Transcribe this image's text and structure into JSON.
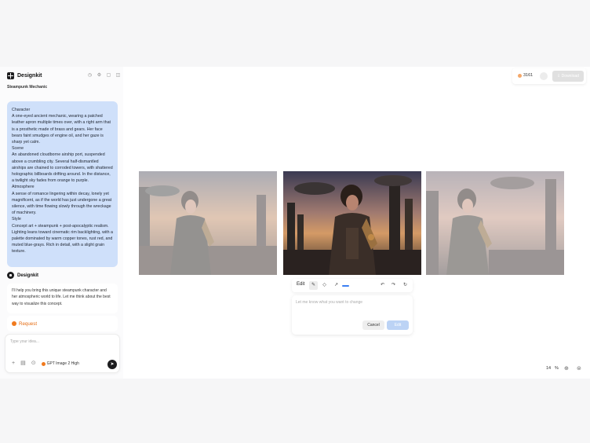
{
  "sidebar": {
    "brand": "Designkit",
    "project_title": "Steampunk Mechanic",
    "user_prompt": "Character\nA one-eyed ancient mechanic, wearing a patched leather apron multiple times over, with a right arm that is a prosthetic made of brass and gears. Her face bears faint smudges of engine oil, and her gaze is sharp yet calm.\nScene\nAn abandoned cloudborne airship port, suspended above a crumbling city. Several half-dismantled airships are chained to corroded towers, with shattered holographic billboards drifting around. In the distance, a twilight sky fades from orange to purple.\nAtmosphere\nA sense of romance lingering within decay, lonely yet magnificent, as if the world has just undergone a great silence, with time flowing slowly through the wreckage of machinery.\nStyle\nConcept art + steampunk + post-apocalyptic realism. Lighting leans toward cinematic rim backlighting, with a palette dominated by warm copper tones, rust red, and muted blue-grays. Rich in detail, with a slight grain texture.",
    "ai_name": "Designkit",
    "ai_message": "I'll help you bring this unique steampunk character and her atmospheric world to life. Let me think about the best way to visualize this concept.",
    "request_label": "Request",
    "input_placeholder": "Type your idea...",
    "model_label": "GPT Image 2 High"
  },
  "topbar": {
    "credits": "3161",
    "download_label": "Download"
  },
  "edit_toolbar": {
    "label": "Edit"
  },
  "prompt_card": {
    "placeholder": "Let me know what you want to change",
    "cancel_label": "Cancel",
    "edit_label": "Edit"
  },
  "zoom": {
    "value": "14",
    "unit": "%"
  },
  "colors": {
    "accent": "#3b7ff2",
    "bubble": "#cfe0fa",
    "request": "#e56c12"
  }
}
